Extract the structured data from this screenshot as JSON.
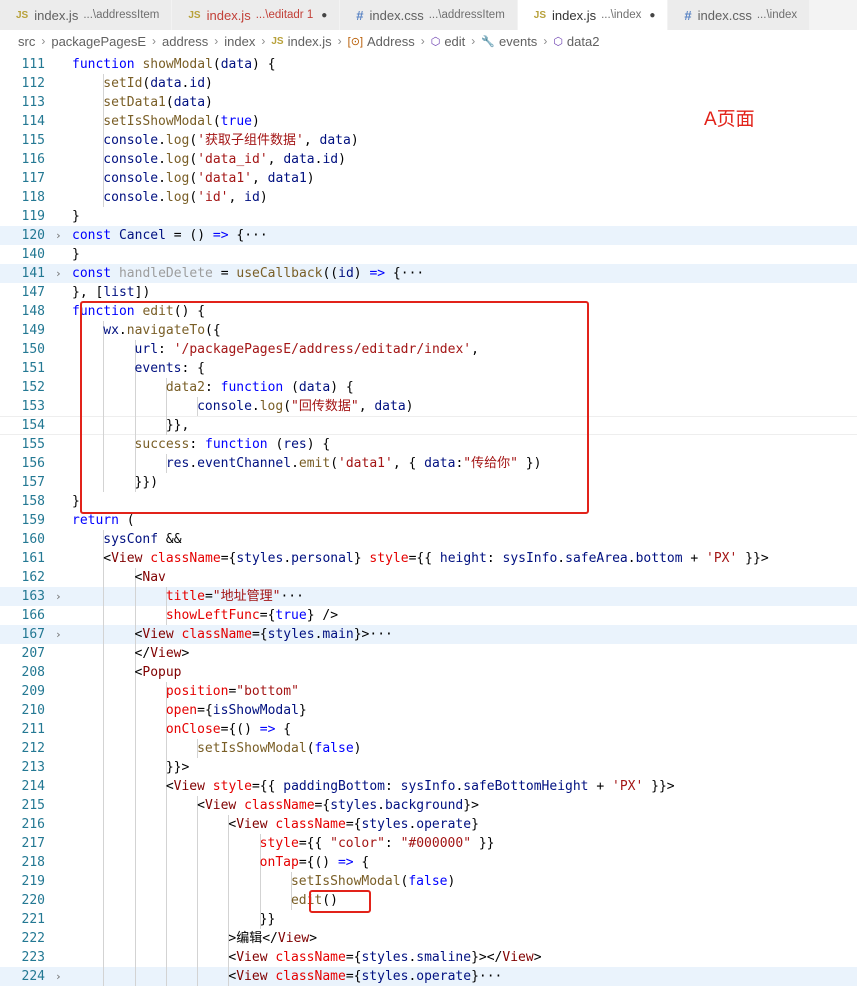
{
  "tabs": [
    {
      "icon": "JS",
      "name": "index.js",
      "desc": "...\\addressItem",
      "active": false,
      "dirty": false,
      "error": false
    },
    {
      "icon": "JS",
      "name": "index.js",
      "desc": "...\\editadr 1",
      "active": false,
      "dirty": true,
      "error": true
    },
    {
      "icon": "#",
      "name": "index.css",
      "desc": "...\\addressItem",
      "active": false,
      "dirty": false,
      "error": false
    },
    {
      "icon": "JS",
      "name": "index.js",
      "desc": "...\\index",
      "active": true,
      "dirty": true,
      "error": false
    },
    {
      "icon": "#",
      "name": "index.css",
      "desc": "...\\index",
      "active": false,
      "dirty": false,
      "error": false
    }
  ],
  "breadcrumb": [
    {
      "icon": "",
      "text": "src"
    },
    {
      "icon": "",
      "text": "packagePagesE"
    },
    {
      "icon": "",
      "text": "address"
    },
    {
      "icon": "",
      "text": "index"
    },
    {
      "icon": "JS",
      "text": "index.js"
    },
    {
      "icon": "[⊙]",
      "text": "Address"
    },
    {
      "icon": "⬡",
      "text": "edit"
    },
    {
      "icon": "🔧",
      "text": "events"
    },
    {
      "icon": "⬡",
      "text": "data2"
    }
  ],
  "annotation": "A页面",
  "colors": {
    "highlight_box": "#e2231a",
    "line_number": "#237893",
    "folded_line_bg": "#eaf3fc"
  },
  "lines": [
    {
      "n": "111",
      "ind": 1,
      "t": [
        [
          "k",
          "function "
        ],
        [
          "fn",
          "showModal"
        ],
        [
          "op",
          "("
        ],
        [
          "v",
          "data"
        ],
        [
          "op",
          ") {"
        ]
      ]
    },
    {
      "n": "112",
      "ind": 2,
      "t": [
        [
          "fn",
          "setId"
        ],
        [
          "op",
          "("
        ],
        [
          "v",
          "data"
        ],
        [
          "op",
          "."
        ],
        [
          "v",
          "id"
        ],
        [
          "op",
          ")"
        ]
      ]
    },
    {
      "n": "113",
      "ind": 2,
      "t": [
        [
          "fn",
          "setData1"
        ],
        [
          "op",
          "("
        ],
        [
          "v",
          "data"
        ],
        [
          "op",
          ")"
        ]
      ]
    },
    {
      "n": "114",
      "ind": 2,
      "t": [
        [
          "fn",
          "setIsShowModal"
        ],
        [
          "op",
          "("
        ],
        [
          "k",
          "true"
        ],
        [
          "op",
          ")"
        ]
      ]
    },
    {
      "n": "115",
      "ind": 2,
      "t": [
        [
          "v",
          "console"
        ],
        [
          "op",
          "."
        ],
        [
          "fn",
          "log"
        ],
        [
          "op",
          "("
        ],
        [
          "s",
          "'获取子组件数据'"
        ],
        [
          "op",
          ", "
        ],
        [
          "v",
          "data"
        ],
        [
          "op",
          ")"
        ]
      ]
    },
    {
      "n": "116",
      "ind": 2,
      "t": [
        [
          "v",
          "console"
        ],
        [
          "op",
          "."
        ],
        [
          "fn",
          "log"
        ],
        [
          "op",
          "("
        ],
        [
          "s",
          "'data_id'"
        ],
        [
          "op",
          ", "
        ],
        [
          "v",
          "data"
        ],
        [
          "op",
          "."
        ],
        [
          "v",
          "id"
        ],
        [
          "op",
          ")"
        ]
      ]
    },
    {
      "n": "117",
      "ind": 2,
      "t": [
        [
          "v",
          "console"
        ],
        [
          "op",
          "."
        ],
        [
          "fn",
          "log"
        ],
        [
          "op",
          "("
        ],
        [
          "s",
          "'data1'"
        ],
        [
          "op",
          ", "
        ],
        [
          "v",
          "data1"
        ],
        [
          "op",
          ")"
        ]
      ]
    },
    {
      "n": "118",
      "ind": 2,
      "t": [
        [
          "v",
          "console"
        ],
        [
          "op",
          "."
        ],
        [
          "fn",
          "log"
        ],
        [
          "op",
          "("
        ],
        [
          "s",
          "'id'"
        ],
        [
          "op",
          ", "
        ],
        [
          "v",
          "id"
        ],
        [
          "op",
          ")"
        ]
      ]
    },
    {
      "n": "119",
      "ind": 1,
      "t": [
        [
          "op",
          "}"
        ]
      ]
    },
    {
      "n": "120",
      "ind": 1,
      "fold": true,
      "hl": true,
      "t": [
        [
          "k",
          "const "
        ],
        [
          "v",
          "Cancel"
        ],
        [
          "op",
          " = () "
        ],
        [
          "k",
          "=>"
        ],
        [
          "op",
          " {···"
        ]
      ]
    },
    {
      "n": "140",
      "ind": 1,
      "t": [
        [
          "op",
          "}"
        ]
      ]
    },
    {
      "n": "141",
      "ind": 1,
      "fold": true,
      "hl": true,
      "t": [
        [
          "k",
          "const "
        ],
        [
          "dim",
          "handleDelete"
        ],
        [
          "op",
          " = "
        ],
        [
          "fn",
          "useCallback"
        ],
        [
          "op",
          "(("
        ],
        [
          "v",
          "id"
        ],
        [
          "op",
          ") "
        ],
        [
          "k",
          "=>"
        ],
        [
          "op",
          " {···"
        ]
      ]
    },
    {
      "n": "147",
      "ind": 1,
      "t": [
        [
          "op",
          "}, ["
        ],
        [
          "v",
          "list"
        ],
        [
          "op",
          "])"
        ]
      ]
    },
    {
      "n": "148",
      "ind": 1,
      "t": [
        [
          "k",
          "function "
        ],
        [
          "fn",
          "edit"
        ],
        [
          "op",
          "() {"
        ]
      ]
    },
    {
      "n": "149",
      "ind": 2,
      "t": [
        [
          "v",
          "wx"
        ],
        [
          "op",
          "."
        ],
        [
          "fn",
          "navigateTo"
        ],
        [
          "op",
          "({"
        ]
      ]
    },
    {
      "n": "150",
      "ind": 3,
      "t": [
        [
          "v",
          "url"
        ],
        [
          "op",
          ": "
        ],
        [
          "s",
          "'/packagePagesE/address/editadr/index'"
        ],
        [
          "op",
          ","
        ]
      ]
    },
    {
      "n": "151",
      "ind": 3,
      "t": [
        [
          "v",
          "events"
        ],
        [
          "op",
          ": {"
        ]
      ]
    },
    {
      "n": "152",
      "ind": 4,
      "t": [
        [
          "fn",
          "data2"
        ],
        [
          "op",
          ": "
        ],
        [
          "k",
          "function "
        ],
        [
          "op",
          "("
        ],
        [
          "v",
          "data"
        ],
        [
          "op",
          ") {"
        ]
      ]
    },
    {
      "n": "153",
      "ind": 5,
      "t": [
        [
          "v",
          "console"
        ],
        [
          "op",
          "."
        ],
        [
          "fn",
          "log"
        ],
        [
          "op",
          "("
        ],
        [
          "s",
          "\"回传数据\""
        ],
        [
          "op",
          ", "
        ],
        [
          "v",
          "data"
        ],
        [
          "op",
          ")"
        ]
      ]
    },
    {
      "n": "154",
      "ind": 4,
      "cur": true,
      "t": [
        [
          "op",
          "}},"
        ]
      ]
    },
    {
      "n": "155",
      "ind": 3,
      "t": [
        [
          "fn",
          "success"
        ],
        [
          "op",
          ": "
        ],
        [
          "k",
          "function "
        ],
        [
          "op",
          "("
        ],
        [
          "v",
          "res"
        ],
        [
          "op",
          ") {"
        ]
      ]
    },
    {
      "n": "156",
      "ind": 4,
      "t": [
        [
          "v",
          "res"
        ],
        [
          "op",
          "."
        ],
        [
          "v",
          "eventChannel"
        ],
        [
          "op",
          "."
        ],
        [
          "fn",
          "emit"
        ],
        [
          "op",
          "("
        ],
        [
          "s",
          "'data1'"
        ],
        [
          "op",
          ", { "
        ],
        [
          "v",
          "data"
        ],
        [
          "op",
          ":"
        ],
        [
          "s",
          "\"传给你\""
        ],
        [
          "op",
          " })"
        ]
      ]
    },
    {
      "n": "157",
      "ind": 3,
      "t": [
        [
          "op",
          "}})"
        ]
      ]
    },
    {
      "n": "158",
      "ind": 1,
      "t": [
        [
          "op",
          "}"
        ]
      ]
    },
    {
      "n": "159",
      "ind": 1,
      "t": [
        [
          "k",
          "return "
        ],
        [
          "op",
          "("
        ]
      ]
    },
    {
      "n": "160",
      "ind": 2,
      "t": [
        [
          "v",
          "sysConf"
        ],
        [
          "op",
          " &&"
        ]
      ]
    },
    {
      "n": "161",
      "ind": 2,
      "t": [
        [
          "op",
          "<"
        ],
        [
          "t",
          "View "
        ],
        [
          "a",
          "className"
        ],
        [
          "op",
          "={"
        ],
        [
          "v",
          "styles"
        ],
        [
          "op",
          "."
        ],
        [
          "v",
          "personal"
        ],
        [
          "op",
          "} "
        ],
        [
          "a",
          "style"
        ],
        [
          "op",
          "={{ "
        ],
        [
          "v",
          "height"
        ],
        [
          "op",
          ": "
        ],
        [
          "v",
          "sysInfo"
        ],
        [
          "op",
          "."
        ],
        [
          "v",
          "safeArea"
        ],
        [
          "op",
          "."
        ],
        [
          "v",
          "bottom"
        ],
        [
          "op",
          " + "
        ],
        [
          "s",
          "'PX'"
        ],
        [
          "op",
          " }}>"
        ]
      ]
    },
    {
      "n": "162",
      "ind": 3,
      "t": [
        [
          "op",
          "<"
        ],
        [
          "t",
          "Nav"
        ]
      ]
    },
    {
      "n": "163",
      "ind": 4,
      "fold": true,
      "hl": true,
      "t": [
        [
          "a",
          "title"
        ],
        [
          "op",
          "="
        ],
        [
          "s",
          "\"地址管理\""
        ],
        [
          "op",
          "···"
        ]
      ]
    },
    {
      "n": "166",
      "ind": 4,
      "t": [
        [
          "a",
          "showLeftFunc"
        ],
        [
          "op",
          "={"
        ],
        [
          "k",
          "true"
        ],
        [
          "op",
          "} />"
        ]
      ]
    },
    {
      "n": "167",
      "ind": 3,
      "fold": true,
      "hl": true,
      "t": [
        [
          "op",
          "<"
        ],
        [
          "t",
          "View "
        ],
        [
          "a",
          "className"
        ],
        [
          "op",
          "={"
        ],
        [
          "v",
          "styles"
        ],
        [
          "op",
          "."
        ],
        [
          "v",
          "main"
        ],
        [
          "op",
          "}>···"
        ]
      ]
    },
    {
      "n": "207",
      "ind": 3,
      "t": [
        [
          "op",
          "</"
        ],
        [
          "t",
          "View"
        ],
        [
          "op",
          ">"
        ]
      ]
    },
    {
      "n": "208",
      "ind": 3,
      "t": [
        [
          "op",
          "<"
        ],
        [
          "t",
          "Popup"
        ]
      ]
    },
    {
      "n": "209",
      "ind": 4,
      "t": [
        [
          "a",
          "position"
        ],
        [
          "op",
          "="
        ],
        [
          "s",
          "\"bottom\""
        ]
      ]
    },
    {
      "n": "210",
      "ind": 4,
      "t": [
        [
          "a",
          "open"
        ],
        [
          "op",
          "={"
        ],
        [
          "v",
          "isShowModal"
        ],
        [
          "op",
          "}"
        ]
      ]
    },
    {
      "n": "211",
      "ind": 4,
      "t": [
        [
          "a",
          "onClose"
        ],
        [
          "op",
          "={() "
        ],
        [
          "k",
          "=>"
        ],
        [
          "op",
          " {"
        ]
      ]
    },
    {
      "n": "212",
      "ind": 5,
      "t": [
        [
          "fn",
          "setIsShowModal"
        ],
        [
          "op",
          "("
        ],
        [
          "k",
          "false"
        ],
        [
          "op",
          ")"
        ]
      ]
    },
    {
      "n": "213",
      "ind": 4,
      "t": [
        [
          "op",
          "}}>"
        ]
      ]
    },
    {
      "n": "214",
      "ind": 4,
      "t": [
        [
          "op",
          "<"
        ],
        [
          "t",
          "View "
        ],
        [
          "a",
          "style"
        ],
        [
          "op",
          "={{ "
        ],
        [
          "v",
          "paddingBottom"
        ],
        [
          "op",
          ": "
        ],
        [
          "v",
          "sysInfo"
        ],
        [
          "op",
          "."
        ],
        [
          "v",
          "safeBottomHeight"
        ],
        [
          "op",
          " + "
        ],
        [
          "s",
          "'PX'"
        ],
        [
          "op",
          " }}>"
        ]
      ]
    },
    {
      "n": "215",
      "ind": 5,
      "t": [
        [
          "op",
          "<"
        ],
        [
          "t",
          "View "
        ],
        [
          "a",
          "className"
        ],
        [
          "op",
          "={"
        ],
        [
          "v",
          "styles"
        ],
        [
          "op",
          "."
        ],
        [
          "v",
          "background"
        ],
        [
          "op",
          "}>"
        ]
      ]
    },
    {
      "n": "216",
      "ind": 6,
      "t": [
        [
          "op",
          "<"
        ],
        [
          "t",
          "View "
        ],
        [
          "a",
          "className"
        ],
        [
          "op",
          "={"
        ],
        [
          "v",
          "styles"
        ],
        [
          "op",
          "."
        ],
        [
          "v",
          "operate"
        ],
        [
          "op",
          "}"
        ]
      ]
    },
    {
      "n": "217",
      "ind": 7,
      "t": [
        [
          "a",
          "style"
        ],
        [
          "op",
          "={{ "
        ],
        [
          "s",
          "\"color\""
        ],
        [
          "op",
          ": "
        ],
        [
          "s",
          "\"#000000\""
        ],
        [
          "op",
          " }}"
        ]
      ]
    },
    {
      "n": "218",
      "ind": 7,
      "t": [
        [
          "a",
          "onTap"
        ],
        [
          "op",
          "={() "
        ],
        [
          "k",
          "=>"
        ],
        [
          "op",
          " {"
        ]
      ]
    },
    {
      "n": "219",
      "ind": 8,
      "t": [
        [
          "fn",
          "setIsShowModal"
        ],
        [
          "op",
          "("
        ],
        [
          "k",
          "false"
        ],
        [
          "op",
          ")"
        ]
      ]
    },
    {
      "n": "220",
      "ind": 8,
      "t": [
        [
          "fn",
          "edit"
        ],
        [
          "op",
          "()"
        ]
      ]
    },
    {
      "n": "221",
      "ind": 7,
      "t": [
        [
          "op",
          "}}"
        ]
      ]
    },
    {
      "n": "222",
      "ind": 6,
      "t": [
        [
          "op",
          ">编辑</"
        ],
        [
          "t",
          "View"
        ],
        [
          "op",
          ">"
        ]
      ]
    },
    {
      "n": "223",
      "ind": 6,
      "t": [
        [
          "op",
          "<"
        ],
        [
          "t",
          "View "
        ],
        [
          "a",
          "className"
        ],
        [
          "op",
          "={"
        ],
        [
          "v",
          "styles"
        ],
        [
          "op",
          "."
        ],
        [
          "v",
          "smaline"
        ],
        [
          "op",
          "}></"
        ],
        [
          "t",
          "View"
        ],
        [
          "op",
          ">"
        ]
      ]
    },
    {
      "n": "224",
      "ind": 6,
      "fold": true,
      "hl": true,
      "t": [
        [
          "op",
          "<"
        ],
        [
          "t",
          "View "
        ],
        [
          "a",
          "className"
        ],
        [
          "op",
          "={"
        ],
        [
          "v",
          "styles"
        ],
        [
          "op",
          "."
        ],
        [
          "v",
          "operate"
        ],
        [
          "op",
          "}···"
        ]
      ]
    }
  ]
}
